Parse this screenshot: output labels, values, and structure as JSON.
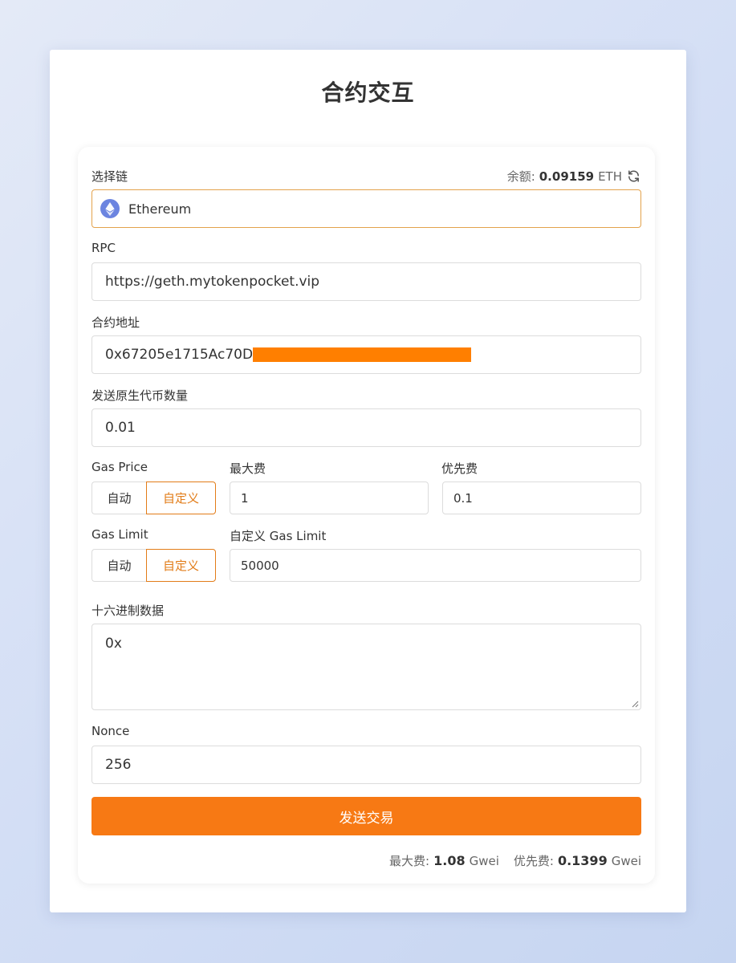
{
  "page": {
    "title": "合约交互"
  },
  "chain": {
    "label": "选择链",
    "selected": "Ethereum",
    "icon": "ethereum-icon",
    "balance_label": "余额:",
    "balance_value": "0.09159",
    "balance_unit": "ETH"
  },
  "rpc": {
    "label": "RPC",
    "value": "https://geth.mytokenpocket.vip"
  },
  "contract": {
    "label": "合约地址",
    "value": "0x67205e1715Ac70D"
  },
  "native_amount": {
    "label": "发送原生代币数量",
    "value": "0.01"
  },
  "gas_price": {
    "label": "Gas Price",
    "auto_label": "自动",
    "custom_label": "自定义",
    "max_fee_label": "最大费",
    "max_fee_value": "1",
    "priority_fee_label": "优先费",
    "priority_fee_value": "0.1"
  },
  "gas_limit": {
    "label": "Gas Limit",
    "auto_label": "自动",
    "custom_label": "自定义",
    "custom_field_label": "自定义 Gas Limit",
    "custom_field_value": "50000"
  },
  "hex_data": {
    "label": "十六进制数据",
    "value": "0x"
  },
  "nonce": {
    "label": "Nonce",
    "value": "256"
  },
  "send_button": {
    "label": "发送交易"
  },
  "fee_summary": {
    "max_fee_label": "最大费:",
    "max_fee_value": "1.08",
    "max_fee_unit": "Gwei",
    "priority_fee_label": "优先费:",
    "priority_fee_value": "0.1399",
    "priority_fee_unit": "Gwei"
  },
  "colors": {
    "accent": "#f77914",
    "selected_border": "#e27c18",
    "focus_border": "#e3a24c",
    "redaction": "#ff7f00"
  }
}
